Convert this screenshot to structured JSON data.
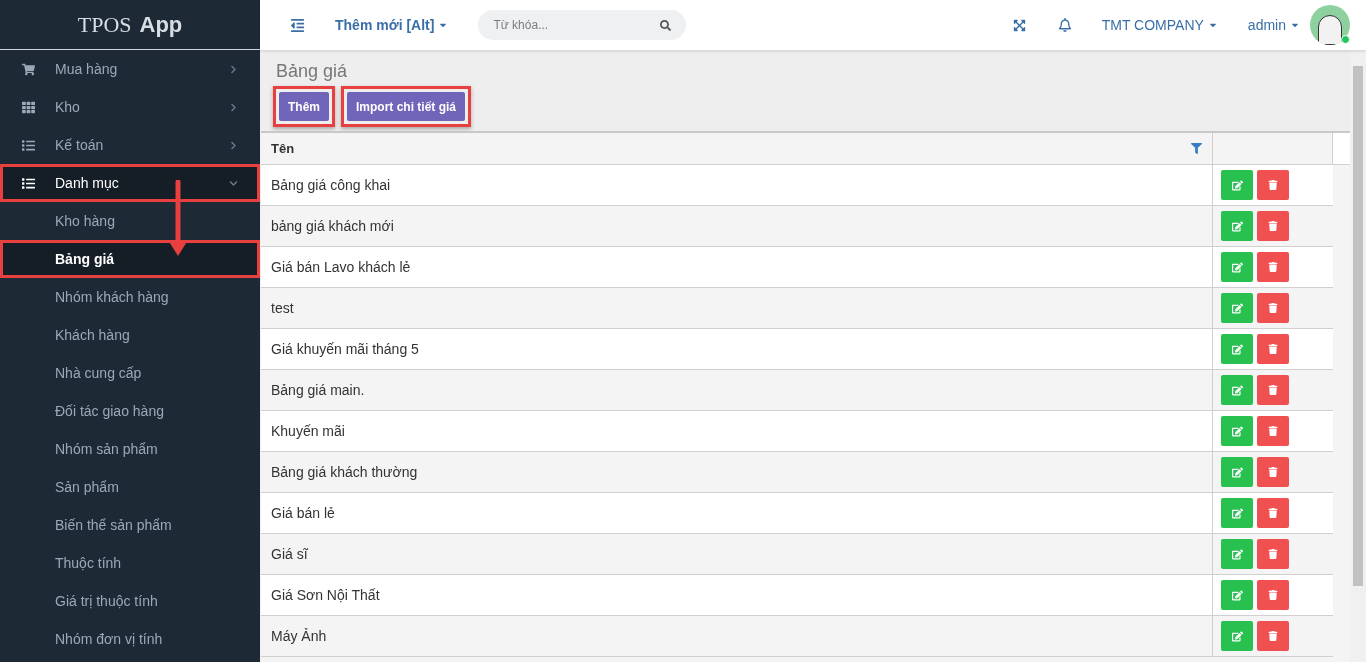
{
  "brand": {
    "light": "TPOS",
    "bold": "App"
  },
  "header": {
    "new_menu": "Thêm mới [Alt]",
    "search": {
      "placeholder": "Từ khóa..."
    },
    "company": "TMT COMPANY",
    "user": "admin",
    "user_online": true
  },
  "sidebar": {
    "items": [
      {
        "label": "Mua hàng",
        "expanded": false,
        "highlighted": false
      },
      {
        "label": "Kho",
        "expanded": false,
        "highlighted": false
      },
      {
        "label": "Kế toán",
        "expanded": false,
        "highlighted": false
      },
      {
        "label": "Danh mục",
        "expanded": true,
        "highlighted": true,
        "children": [
          {
            "label": "Kho hàng",
            "selected": false,
            "highlighted": false
          },
          {
            "label": "Bảng giá",
            "selected": true,
            "highlighted": true
          },
          {
            "label": "Nhóm khách hàng",
            "selected": false,
            "highlighted": false
          },
          {
            "label": "Khách hàng",
            "selected": false,
            "highlighted": false
          },
          {
            "label": "Nhà cung cấp",
            "selected": false,
            "highlighted": false
          },
          {
            "label": "Đối tác giao hàng",
            "selected": false,
            "highlighted": false
          },
          {
            "label": "Nhóm sản phẩm",
            "selected": false,
            "highlighted": false
          },
          {
            "label": "Sản phẩm",
            "selected": false,
            "highlighted": false
          },
          {
            "label": "Biến thể sản phẩm",
            "selected": false,
            "highlighted": false
          },
          {
            "label": "Thuộc tính",
            "selected": false,
            "highlighted": false
          },
          {
            "label": "Giá trị thuộc tính",
            "selected": false,
            "highlighted": false
          },
          {
            "label": "Nhóm đơn vị tính",
            "selected": false,
            "highlighted": false
          }
        ]
      }
    ]
  },
  "page": {
    "title": "Bảng giá",
    "buttons": [
      {
        "label": "Thêm",
        "highlighted": true
      },
      {
        "label": "Import chi tiết giá",
        "highlighted": true
      }
    ]
  },
  "table": {
    "columns": [
      "Tên"
    ],
    "rows": [
      "Bảng giá công khai",
      "bảng giá khách mới",
      "Giá bán Lavo khách lẻ",
      "test",
      "Giá khuyến mãi tháng 5",
      "Bảng giá main.",
      "Khuyến mãi",
      "Bảng giá khách thường",
      "Giá bán lẻ",
      "Giá sĩ",
      "Giá Sơn Nội Thất",
      "Máy Ảnh"
    ]
  }
}
